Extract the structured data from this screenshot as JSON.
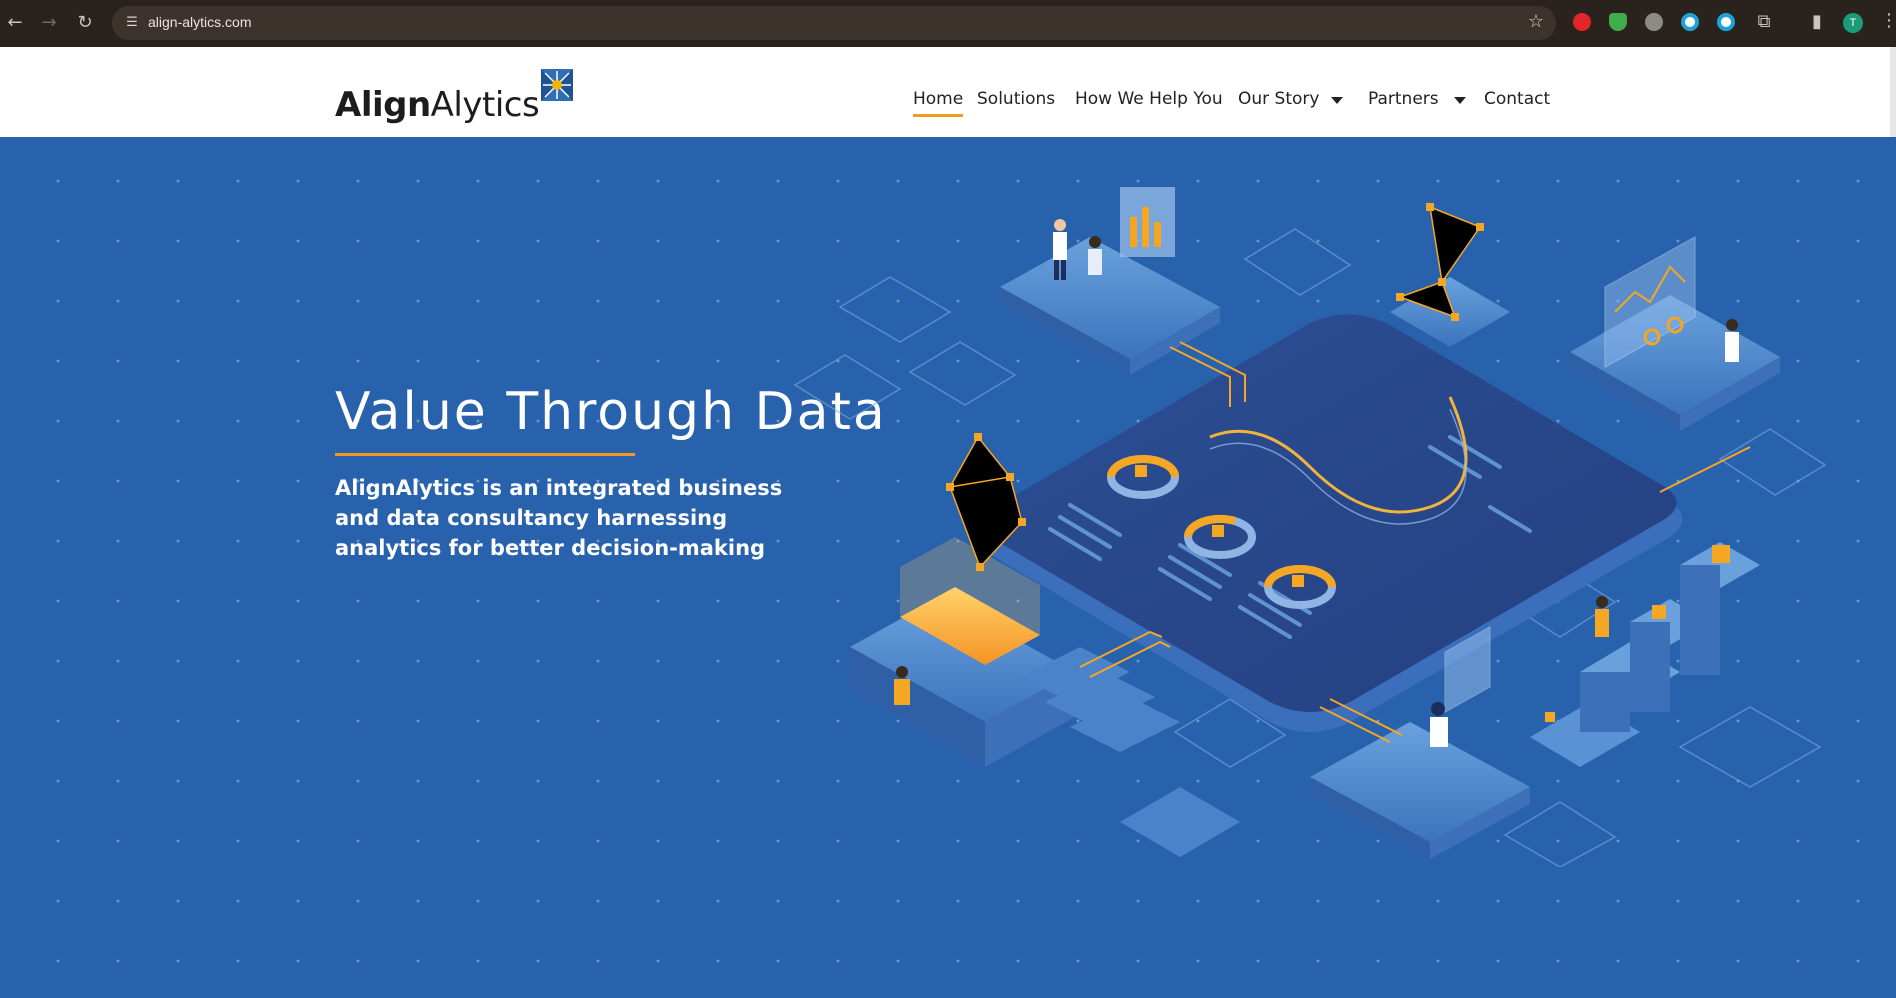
{
  "browser": {
    "url": "align-alytics.com",
    "profile_initial": "T",
    "icons": [
      "back-icon",
      "forward-icon",
      "reload-icon",
      "site-settings-icon",
      "bookmark-star-icon",
      "extensions-icon",
      "side-panel-icon",
      "menu-icon"
    ]
  },
  "site": {
    "logo_part1": "Align",
    "logo_part2": "Alytics",
    "nav": {
      "home": "Home",
      "solutions": "Solutions",
      "how_we_help": "How We Help You",
      "our_story": "Our Story",
      "partners": "Partners",
      "contact": "Contact"
    }
  },
  "hero": {
    "title": "Value Through Data",
    "subtitle": "AlignAlytics is an integrated business and data consultancy harnessing analytics for better decision-making"
  },
  "colors": {
    "hero_bg": "#2962ac",
    "accent": "#f29a1f",
    "header_bg": "#ffffff",
    "chrome_bg": "#2a231d"
  }
}
